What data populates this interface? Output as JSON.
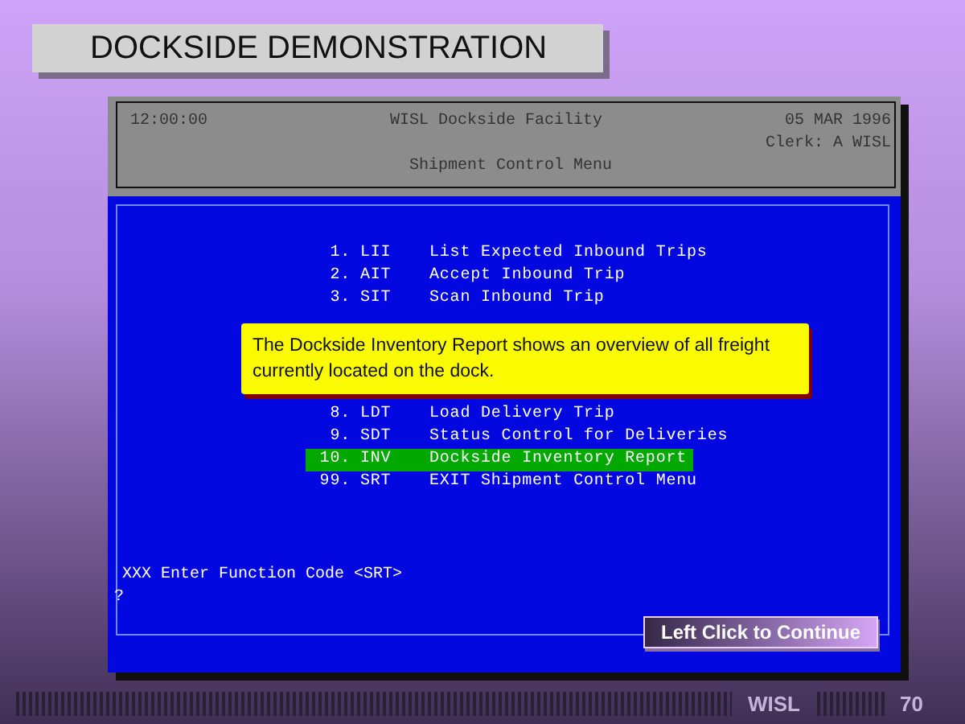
{
  "title": "DOCKSIDE DEMONSTRATION",
  "terminal": {
    "header": {
      "time": "12:00:00",
      "facility": "WISL Dockside Facility",
      "date": "05 MAR 1996",
      "clerk": "Clerk: A WISL",
      "menu_title": "Shipment Control Menu"
    },
    "menu_items_above": [
      {
        "number": "1.",
        "code": "LII",
        "label": "List Expected Inbound Trips",
        "selected": false
      },
      {
        "number": "2.",
        "code": "AIT",
        "label": "Accept Inbound Trip",
        "selected": false
      },
      {
        "number": "3.",
        "code": "SIT",
        "label": "Scan Inbound Trip",
        "selected": false
      }
    ],
    "menu_items_below": [
      {
        "number": "8.",
        "code": "LDT",
        "label": "Load Delivery Trip",
        "selected": false
      },
      {
        "number": "9.",
        "code": "SDT",
        "label": "Status Control for Deliveries",
        "selected": false
      },
      {
        "number": "10.",
        "code": "INV",
        "label": "Dockside Inventory Report",
        "selected": true
      },
      {
        "number": "99.",
        "code": "SRT",
        "label": "EXIT Shipment Control Menu",
        "selected": false
      }
    ],
    "prompt": "XXX Enter Function Code <SRT>",
    "input": "?"
  },
  "callout": {
    "text": "The Dockside Inventory Report shows an overview of all freight currently located on the dock."
  },
  "continue_button": {
    "label": "Left Click to Continue"
  },
  "footer": {
    "brand": "WISL",
    "page": "70"
  }
}
